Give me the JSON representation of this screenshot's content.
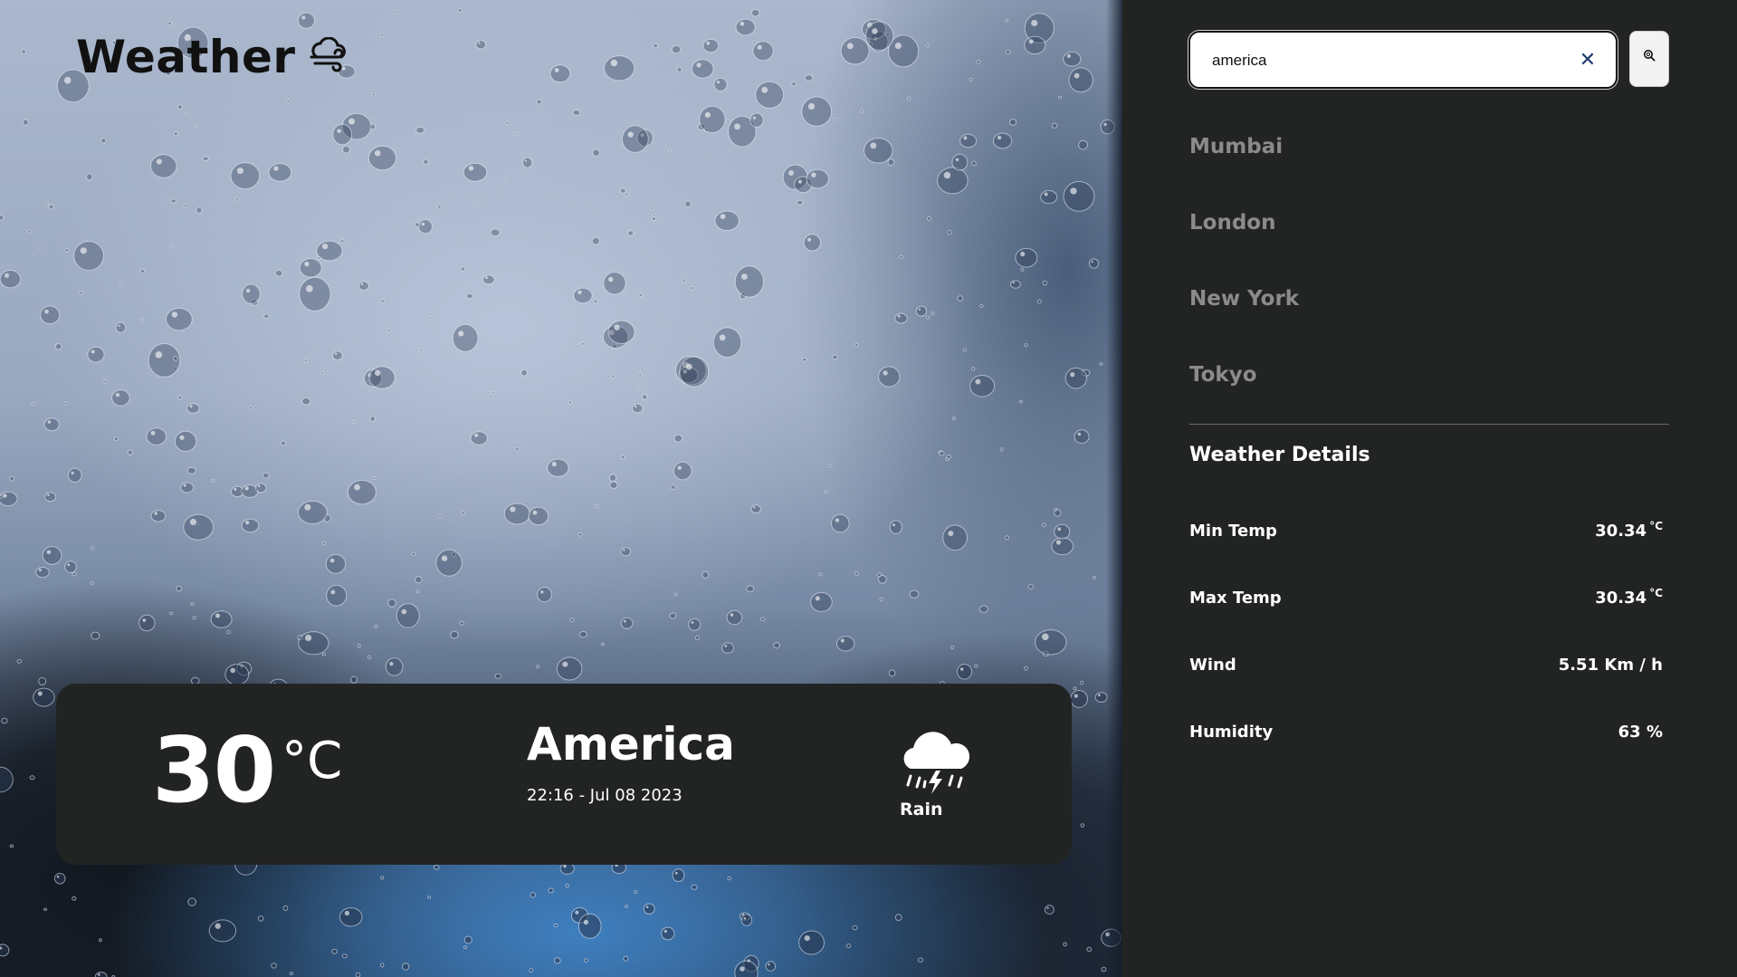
{
  "app": {
    "title": "Weather",
    "logo_icon": "wind-cloud-icon"
  },
  "current": {
    "temperature": "30",
    "unit": "°C",
    "city": "America",
    "datetime": "22:16 - Jul 08 2023",
    "condition": "Rain",
    "condition_icon": "thunder-rain-cloud-icon"
  },
  "search": {
    "value": "america",
    "clear_icon": "close-icon",
    "button_icon": "search-icon"
  },
  "cities": [
    {
      "label": "Mumbai"
    },
    {
      "label": "London"
    },
    {
      "label": "New York"
    },
    {
      "label": "Tokyo"
    }
  ],
  "details": {
    "title": "Weather Details",
    "rows": [
      {
        "label": "Min Temp",
        "value": "30.34",
        "unit": "°C"
      },
      {
        "label": "Max Temp",
        "value": "30.34",
        "unit": "°C"
      },
      {
        "label": "Wind",
        "value": "5.51 Km / h",
        "unit": ""
      },
      {
        "label": "Humidity",
        "value": "63 %",
        "unit": ""
      }
    ]
  },
  "colors": {
    "panel_bg": "#222424",
    "city_text": "#8b8b8b",
    "clear_icon": "#1e3b6b"
  }
}
